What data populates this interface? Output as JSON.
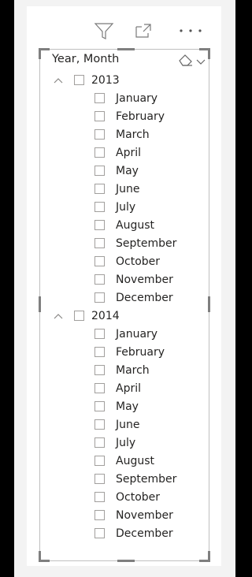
{
  "header": {
    "icons": [
      "filter-icon",
      "focus-mode-icon",
      "more-options-icon"
    ],
    "more_label": "···"
  },
  "slicer": {
    "title": "Year, Month",
    "icons": [
      "eraser-icon",
      "chevron-down-icon"
    ],
    "years": [
      {
        "label": "2013",
        "expanded": true,
        "months": [
          "January",
          "February",
          "March",
          "April",
          "May",
          "June",
          "July",
          "August",
          "September",
          "October",
          "November",
          "December"
        ]
      },
      {
        "label": "2014",
        "expanded": true,
        "months": [
          "January",
          "February",
          "March",
          "April",
          "May",
          "June",
          "July",
          "August",
          "September",
          "October",
          "November",
          "December"
        ]
      }
    ]
  },
  "colors": {
    "background": "#000000",
    "panel": "#f3f3f3",
    "canvas": "#ffffff",
    "text": "#252423",
    "checkbox_border": "#a19f9d",
    "handle": "#7f7f7f"
  }
}
